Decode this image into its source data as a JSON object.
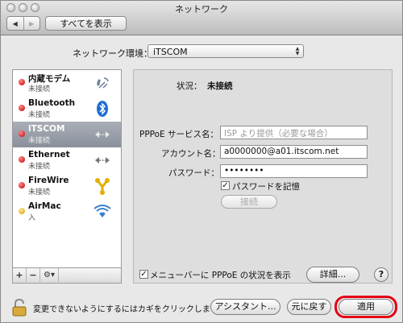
{
  "window": {
    "title": "ネットワーク"
  },
  "toolbar": {
    "back_label": "◀",
    "forward_label": "▶",
    "show_all_label": "すべてを表示"
  },
  "location": {
    "label": "ネットワーク環境：",
    "value": "iTSCOM"
  },
  "services": [
    {
      "name": "内蔵モデム",
      "status": "未接続",
      "status_color": "#d40000",
      "icon": "modem-icon"
    },
    {
      "name": "Bluetooth",
      "status": "未接続",
      "status_color": "#d40000",
      "icon": "bluetooth-icon"
    },
    {
      "name": "iTSCOM",
      "status": "未接続",
      "status_color": "#d40000",
      "icon": "pppoe-arrows-icon",
      "selected": true
    },
    {
      "name": "Ethernet",
      "status": "未接続",
      "status_color": "#d40000",
      "icon": "ethernet-arrows-icon"
    },
    {
      "name": "FireWire",
      "status": "未接続",
      "status_color": "#d40000",
      "icon": "firewire-icon"
    },
    {
      "name": "AirMac",
      "status": "入",
      "status_color": "#e0b000",
      "icon": "wifi-icon"
    }
  ],
  "sidebar_buttons": {
    "add": "+",
    "remove": "−",
    "gear": "⚙▾"
  },
  "detail": {
    "status_label": "状況：",
    "status_value": "未接続",
    "service_name_label": "PPPoE サービス名：",
    "service_name_placeholder": "ISP より提供（必要な場合）",
    "account_label": "アカウント名：",
    "account_value": "a0000000@a01.itscom.net",
    "password_label": "パスワード：",
    "password_value": "••••••••",
    "remember_password_label": "パスワードを記憶",
    "remember_password_checked": true,
    "connect_label": "接続",
    "menubar_label": "メニューバーに PPPoE の状況を表示",
    "menubar_checked": true,
    "advanced_label": "詳細...",
    "help_label": "?"
  },
  "footer": {
    "lock_text": "変更できないようにするにはカギをクリックします。",
    "assistant_label": "アシスタント...",
    "revert_label": "元に戻す",
    "apply_label": "適用"
  },
  "colors": {
    "highlight": "#e60012",
    "selected_row": "#8a909b"
  }
}
